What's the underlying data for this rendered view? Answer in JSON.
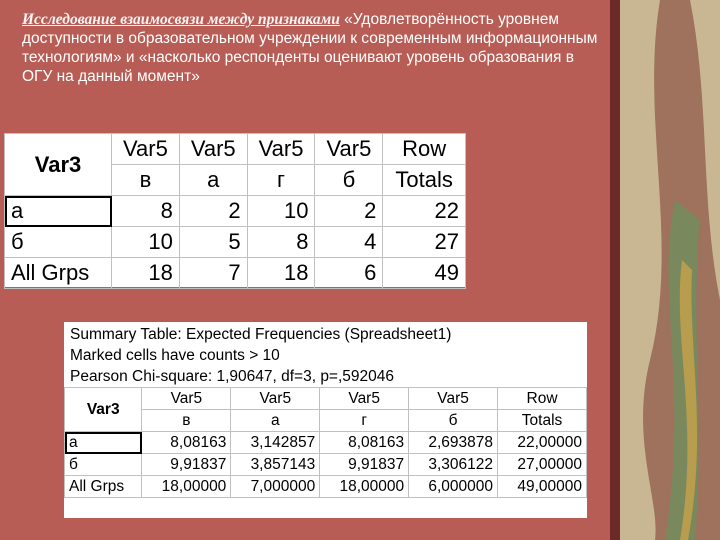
{
  "title": {
    "bold": "Исследование взаимосвязи между признаками",
    "rest": " «Удовлетворённость уровнем доступности в образовательном учреждении к современным информационным технологиям» и «насколько респонденты оценивают уровень образования в ОГУ на данный момент»"
  },
  "table1": {
    "corner": "Var3",
    "columns": [
      {
        "l1": "Var5",
        "l2": "в"
      },
      {
        "l1": "Var5",
        "l2": "а"
      },
      {
        "l1": "Var5",
        "l2": "г"
      },
      {
        "l1": "Var5",
        "l2": "б"
      },
      {
        "l1": "Row",
        "l2": "Totals"
      }
    ],
    "rows": [
      {
        "label": "а",
        "values": [
          "8",
          "2",
          "10",
          "2",
          "22"
        ]
      },
      {
        "label": "б",
        "values": [
          "10",
          "5",
          "8",
          "4",
          "27"
        ]
      },
      {
        "label": "All Grps",
        "values": [
          "18",
          "7",
          "18",
          "6",
          "49"
        ]
      }
    ]
  },
  "table2": {
    "summary": [
      "Summary Table: Expected Frequencies (Spreadsheet1)",
      "Marked cells have counts > 10",
      "Pearson Chi-square: 1,90647, df=3, p=,592046"
    ],
    "corner": "Var3",
    "columns": [
      {
        "l1": "Var5",
        "l2": "в"
      },
      {
        "l1": "Var5",
        "l2": "а"
      },
      {
        "l1": "Var5",
        "l2": "г"
      },
      {
        "l1": "Var5",
        "l2": "б"
      },
      {
        "l1": "Row",
        "l2": "Totals"
      }
    ],
    "rows": [
      {
        "label": "а",
        "values": [
          "8,08163",
          "3,142857",
          "8,08163",
          "2,693878",
          "22,00000"
        ]
      },
      {
        "label": "б",
        "values": [
          "9,91837",
          "3,857143",
          "9,91837",
          "3,306122",
          "27,00000"
        ]
      },
      {
        "label": "All Grps",
        "values": [
          "18,00000",
          "7,000000",
          "18,00000",
          "6,000000",
          "49,00000"
        ]
      }
    ]
  },
  "colors": {
    "background": "#b85d55",
    "border": "#6b2a27",
    "decor": "#c9b692"
  }
}
